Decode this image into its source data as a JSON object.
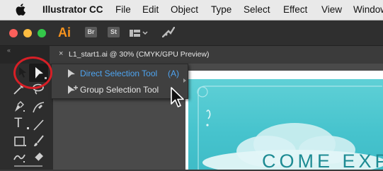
{
  "menubar": {
    "app_name": "Illustrator CC",
    "items": [
      "File",
      "Edit",
      "Object",
      "Type",
      "Select",
      "Effect",
      "View",
      "Window"
    ]
  },
  "appbar": {
    "app_icon_label": "Ai",
    "bridge_label": "Br",
    "stock_label": "St",
    "colors": {
      "close": "#fc605b",
      "minimize": "#fdbc40",
      "zoom": "#34c84a",
      "ai_accent": "#f7931e"
    }
  },
  "document_tab": {
    "close_label": "×",
    "title": "L1_start1.ai @ 30% (CMYK/GPU Preview)"
  },
  "flyout": {
    "items": [
      {
        "label": "Direct Selection Tool",
        "shortcut": "(A)",
        "icon": "direct-selection-icon",
        "active": true
      },
      {
        "label": "Group Selection Tool",
        "shortcut": "",
        "icon": "group-selection-icon",
        "active": false
      }
    ],
    "colors": {
      "active_text": "#4ea4f0",
      "text": "#e6e6e6"
    }
  },
  "toolbar": {
    "tools": [
      "selection-tool",
      "direct-selection-tool",
      "magic-wand-tool",
      "lasso-tool",
      "pen-tool",
      "curvature-tool",
      "type-tool",
      "line-tool",
      "rectangle-tool",
      "paintbrush-tool",
      "shaper-tool",
      "eraser-tool"
    ]
  },
  "artwork": {
    "headline_partial": "COME EXP",
    "colors": {
      "teal": "#4cc6cf",
      "text": "#1d8b93"
    }
  },
  "annotation": {
    "callout_color": "#d61f26"
  }
}
